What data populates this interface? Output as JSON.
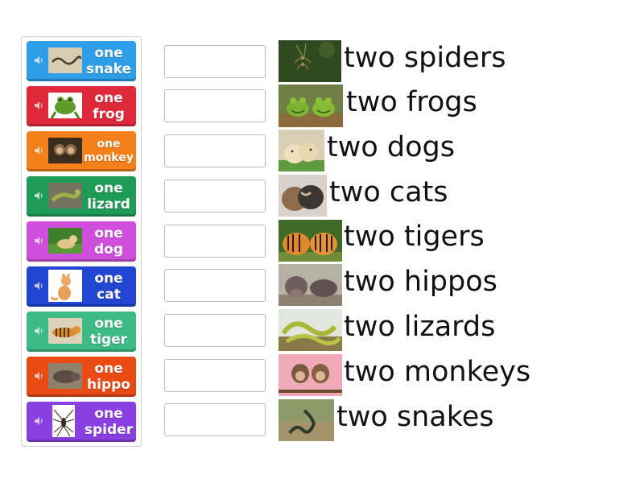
{
  "tiles": [
    {
      "line1": "one",
      "line2": "snake",
      "color": "#2f9ee8",
      "icon": "snake-thumbnail"
    },
    {
      "line1": "one",
      "line2": "frog",
      "color": "#e0283b",
      "icon": "frog-thumbnail"
    },
    {
      "line1": "one",
      "line2": "monkey",
      "color": "#f4801c",
      "icon": "monkey-thumbnail"
    },
    {
      "line1": "one",
      "line2": "lizard",
      "color": "#1e9c57",
      "icon": "lizard-thumbnail"
    },
    {
      "line1": "one",
      "line2": "dog",
      "color": "#cf4fdc",
      "icon": "dog-thumbnail"
    },
    {
      "line1": "one",
      "line2": "cat",
      "color": "#2246d4",
      "icon": "cat-thumbnail"
    },
    {
      "line1": "one",
      "line2": "tiger",
      "color": "#3dbb86",
      "icon": "tiger-thumbnail"
    },
    {
      "line1": "one",
      "line2": "hippo",
      "color": "#ea4a14",
      "icon": "hippo-thumbnail"
    },
    {
      "line1": "one",
      "line2": "spider",
      "color": "#8a3fe0",
      "icon": "spider-thumbnail"
    }
  ],
  "targets": [
    {
      "label": "two spiders",
      "icon": "spiders-photo"
    },
    {
      "label": "two frogs",
      "icon": "frogs-photo"
    },
    {
      "label": "two dogs",
      "icon": "dogs-photo"
    },
    {
      "label": "two cats",
      "icon": "cats-photo"
    },
    {
      "label": "two tigers",
      "icon": "tigers-photo"
    },
    {
      "label": "two hippos",
      "icon": "hippos-photo"
    },
    {
      "label": "two lizards",
      "icon": "lizards-photo"
    },
    {
      "label": "two monkeys",
      "icon": "monkeys-photo"
    },
    {
      "label": "two snakes",
      "icon": "snakes-photo"
    }
  ]
}
